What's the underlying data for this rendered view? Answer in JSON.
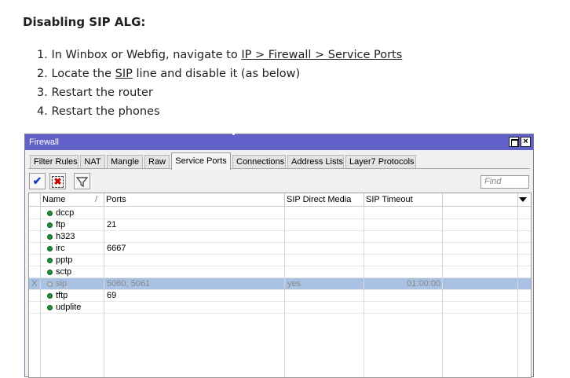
{
  "doc": {
    "title": "Disabling SIP ALG:",
    "steps": [
      {
        "num": "1.",
        "pre": "In Winbox or Webfig, navigate to ",
        "link": "IP > Firewall > Service Ports",
        "post": ""
      },
      {
        "num": "2.",
        "pre": "Locate the ",
        "link": "SIP",
        "post": " line and disable it (as below)"
      },
      {
        "num": "3.",
        "pre": "Restart the router",
        "link": "",
        "post": ""
      },
      {
        "num": "4.",
        "pre": "Restart the phones",
        "link": "",
        "post": ""
      }
    ]
  },
  "window": {
    "title": "Firewall",
    "close_label": "×",
    "tabs": [
      {
        "label": "Filter Rules"
      },
      {
        "label": "NAT"
      },
      {
        "label": "Mangle"
      },
      {
        "label": "Raw"
      },
      {
        "label": "Service Ports",
        "active": true
      },
      {
        "label": "Connections"
      },
      {
        "label": "Address Lists"
      },
      {
        "label": "Layer7 Protocols"
      }
    ],
    "toolbar": {
      "enable_icon": "checkmark-icon",
      "disable_icon": "x-icon",
      "filter_icon": "filter-icon",
      "find_placeholder": "Find"
    },
    "columns": {
      "name": "Name",
      "sort_marker": "/",
      "ports": "Ports",
      "sip_direct_media": "SIP Direct Media",
      "sip_timeout": "SIP Timeout"
    },
    "rows": [
      {
        "flag": "",
        "name": "dccp",
        "ports": "",
        "sip_direct_media": "",
        "sip_timeout": "",
        "disabled": false
      },
      {
        "flag": "",
        "name": "ftp",
        "ports": "21",
        "sip_direct_media": "",
        "sip_timeout": "",
        "disabled": false
      },
      {
        "flag": "",
        "name": "h323",
        "ports": "",
        "sip_direct_media": "",
        "sip_timeout": "",
        "disabled": false
      },
      {
        "flag": "",
        "name": "irc",
        "ports": "6667",
        "sip_direct_media": "",
        "sip_timeout": "",
        "disabled": false
      },
      {
        "flag": "",
        "name": "pptp",
        "ports": "",
        "sip_direct_media": "",
        "sip_timeout": "",
        "disabled": false
      },
      {
        "flag": "",
        "name": "sctp",
        "ports": "",
        "sip_direct_media": "",
        "sip_timeout": "",
        "disabled": false
      },
      {
        "flag": "X",
        "name": "sip",
        "ports": "5060, 5061",
        "sip_direct_media": "yes",
        "sip_timeout": "01:00:00",
        "disabled": true
      },
      {
        "flag": "",
        "name": "tftp",
        "ports": "69",
        "sip_direct_media": "",
        "sip_timeout": "",
        "disabled": false
      },
      {
        "flag": "",
        "name": "udplite",
        "ports": "",
        "sip_direct_media": "",
        "sip_timeout": "",
        "disabled": false
      }
    ],
    "colors": {
      "titlebar": "#6161c9",
      "selected_row": "#a9c1e3",
      "status_enabled": "#1f8f3a"
    }
  }
}
